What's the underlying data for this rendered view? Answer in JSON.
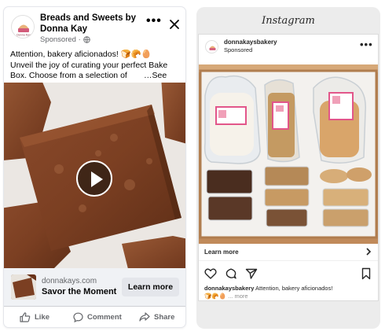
{
  "facebook": {
    "page_name": "Breads and Sweets by Donna Kay",
    "sponsored_label": "Sponsored · ",
    "globe_icon": "globe-icon",
    "primary_text_lines": [
      "Attention, bakery aficionados! 🍞🥐🥚",
      "Unveil the joy of curating your perfect Bake",
      "Box. Choose from a selection of"
    ],
    "see_more": "…See more",
    "link_domain": "donnakays.com",
    "link_headline": "Savor the Moment",
    "cta_label": "Learn more",
    "actions": {
      "like": "Like",
      "comment": "Comment",
      "share": "Share"
    },
    "media": "brownie-video",
    "accent_colors": {
      "text": "#050505",
      "muted": "#65676b",
      "cta_bg": "#e4e6eb",
      "link_bg": "#f0f2f5"
    }
  },
  "instagram": {
    "logo": "Instagram",
    "username": "donnakaysbakery",
    "sponsored_label": "Sponsored",
    "cta_label": "Learn more",
    "caption_user": "donnakaysbakery",
    "caption_text": " Attention, bakery aficionados!",
    "caption_emojis": "🍞🥐🥚",
    "caption_more": "... more",
    "media": "bread-box-photo",
    "icons": [
      "heart-icon",
      "comment-icon",
      "send-icon",
      "bookmark-icon"
    ]
  }
}
